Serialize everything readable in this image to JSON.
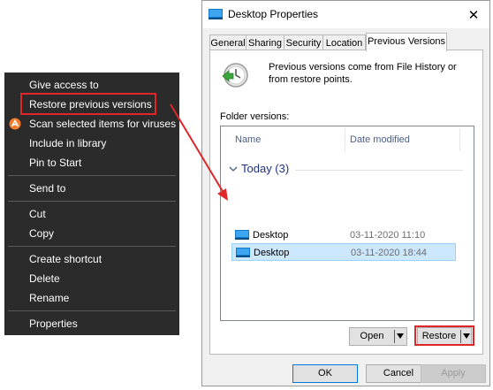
{
  "context_menu": {
    "items": [
      {
        "label": "Give access to"
      },
      {
        "label": "Restore previous versions"
      },
      {
        "label": "Scan selected items for viruses",
        "icon": "antivirus-icon"
      },
      {
        "label": "Include in library"
      },
      {
        "label": "Pin to Start"
      },
      {
        "label": "Send to"
      },
      {
        "label": "Cut"
      },
      {
        "label": "Copy"
      },
      {
        "label": "Create shortcut"
      },
      {
        "label": "Delete"
      },
      {
        "label": "Rename"
      },
      {
        "label": "Properties"
      }
    ]
  },
  "dialog": {
    "title": "Desktop Properties",
    "close_label": "✕",
    "tabs": [
      {
        "label": "General"
      },
      {
        "label": "Sharing"
      },
      {
        "label": "Security"
      },
      {
        "label": "Location"
      },
      {
        "label": "Previous Versions",
        "active": true
      }
    ],
    "info_text": "Previous versions come from File History or from restore points.",
    "folder_versions_label": "Folder versions:",
    "columns": {
      "name": "Name",
      "date_modified": "Date modified"
    },
    "group": {
      "label": "Today (3)"
    },
    "rows": [
      {
        "name": "Desktop",
        "date": "03-11-2020 11:10"
      },
      {
        "name": "Desktop",
        "date": "03-11-2020 18:44",
        "selected": true
      }
    ],
    "open_button": "Open",
    "restore_button": "Restore",
    "ok_button": "OK",
    "cancel_button": "Cancel",
    "apply_button": "Apply"
  },
  "colors": {
    "highlight": "#e0262b",
    "menu_bg": "#2b2b2b",
    "selection": "#cce8ff"
  }
}
